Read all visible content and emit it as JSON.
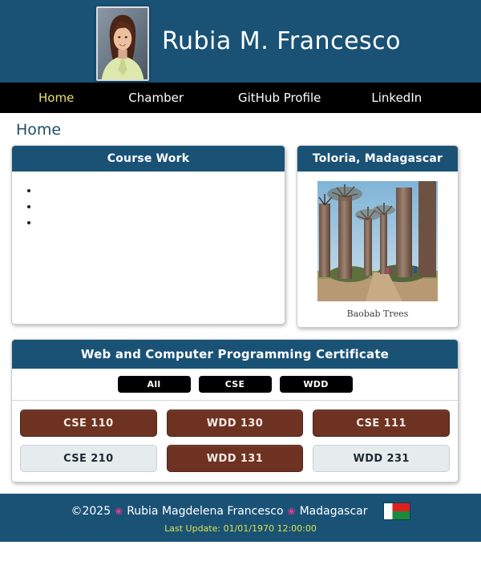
{
  "header": {
    "title": "Rubia M. Francesco",
    "photo_alt": "portrait-photo"
  },
  "nav": {
    "items": [
      {
        "label": "Home",
        "active": true
      },
      {
        "label": "Chamber",
        "active": false
      },
      {
        "label": "GitHub Profile",
        "active": false
      },
      {
        "label": "LinkedIn",
        "active": false
      }
    ]
  },
  "main": {
    "page_title": "Home",
    "course_work_card": {
      "title": "Course Work",
      "items": [
        "",
        "",
        ""
      ]
    },
    "toloria_card": {
      "title": "Toloria, Madagascar",
      "caption": "Baobab Trees"
    },
    "certificate_card": {
      "title": "Web and Computer Programming Certificate",
      "filters": [
        "All",
        "CSE",
        "WDD"
      ],
      "courses": [
        {
          "code": "CSE 110",
          "state": "completed"
        },
        {
          "code": "WDD 130",
          "state": "completed"
        },
        {
          "code": "CSE 111",
          "state": "completed"
        },
        {
          "code": "CSE 210",
          "state": "pending"
        },
        {
          "code": "WDD 131",
          "state": "completed"
        },
        {
          "code": "WDD 231",
          "state": "pending"
        }
      ]
    }
  },
  "footer": {
    "copyright": "©2025",
    "flower": "❀",
    "name": "Rubia Magdelena Francesco",
    "country": "Madagascar",
    "last_update": "Last Update: 01/01/1970 12:00:00",
    "flag_alt": "madagascar-flag"
  },
  "colors": {
    "header_blue": "#1a5276",
    "nav_black": "#000000",
    "active_nav": "#e8e267",
    "tile_completed": "#6e3222",
    "tile_pending": "#e6ecee",
    "last_update_green": "#d9e24a",
    "flower_pink": "#ec3a8e"
  }
}
